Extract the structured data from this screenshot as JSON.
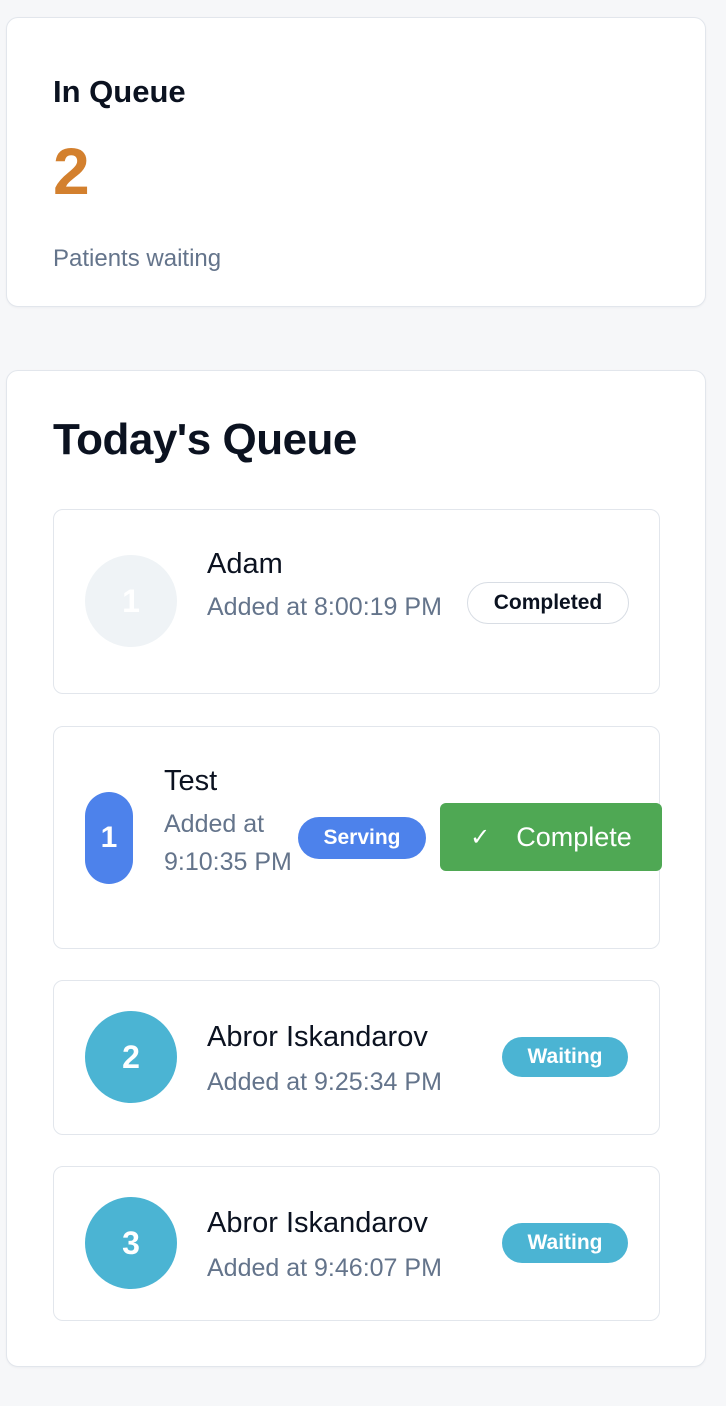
{
  "stats": {
    "label": "In Queue",
    "value": "2",
    "sub": "Patients waiting"
  },
  "queue": {
    "title": "Today's Queue",
    "entries": [
      {
        "number": "1",
        "name": "Adam",
        "time": "Added at 8:00:19 PM",
        "status": "Completed"
      },
      {
        "number": "1",
        "name": "Test",
        "time": "Added at 9:10:35 PM",
        "status": "Serving",
        "action": "Complete",
        "action_icon": "check-icon"
      },
      {
        "number": "2",
        "name": "Abror Iskandarov",
        "time": "Added at 9:25:34 PM",
        "status": "Waiting"
      },
      {
        "number": "3",
        "name": "Abror Iskandarov",
        "time": "Added at 9:46:07 PM",
        "status": "Waiting"
      }
    ]
  },
  "colors": {
    "accent_orange": "#d3802e",
    "serving_blue": "#4d82eb",
    "waiting_teal": "#4bb4d3",
    "complete_green": "#4fa854"
  }
}
